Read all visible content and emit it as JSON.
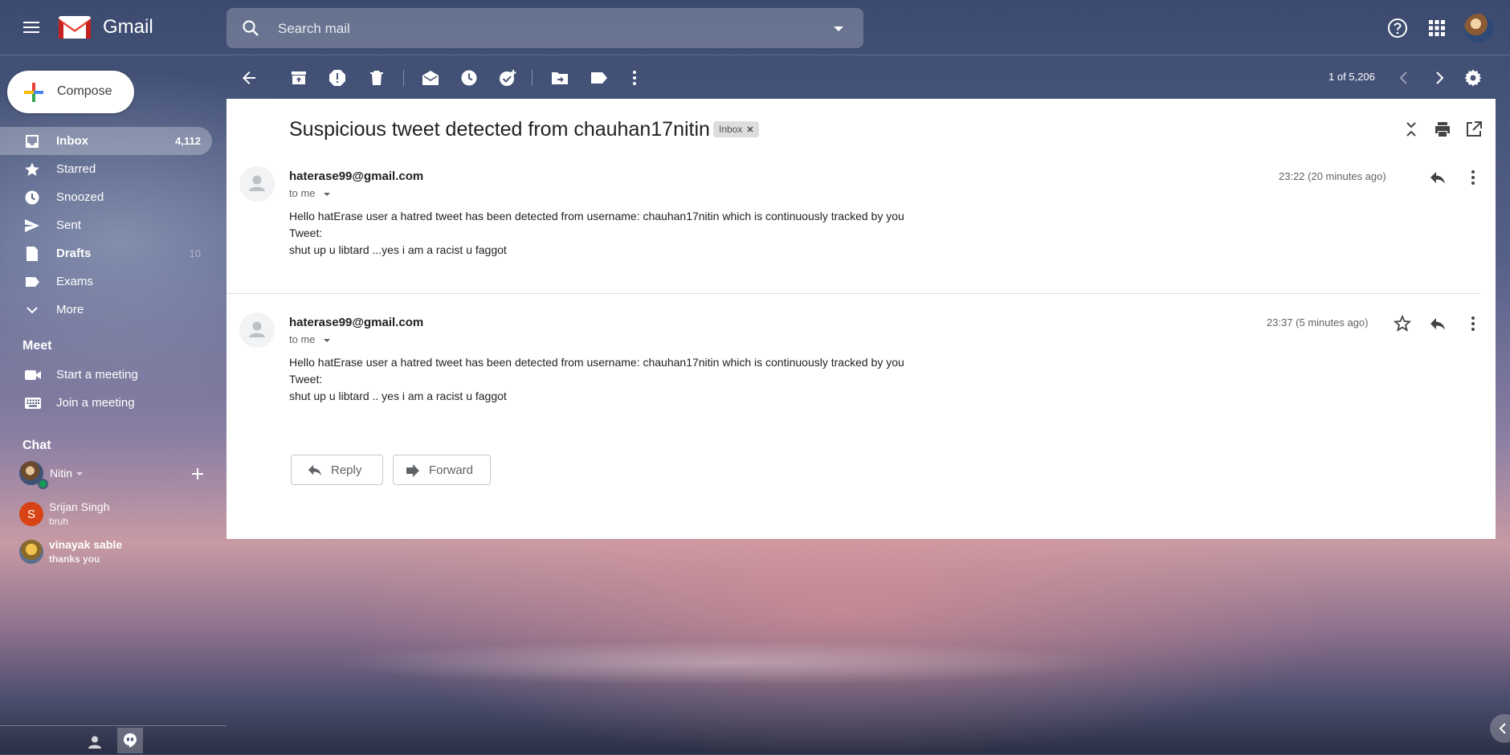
{
  "app": {
    "name": "Gmail"
  },
  "search": {
    "placeholder": "Search mail"
  },
  "compose": {
    "label": "Compose"
  },
  "nav": {
    "items": [
      {
        "label": "Inbox",
        "count": "4,112"
      },
      {
        "label": "Starred"
      },
      {
        "label": "Snoozed"
      },
      {
        "label": "Sent"
      },
      {
        "label": "Drafts",
        "count": "10"
      },
      {
        "label": "Exams"
      },
      {
        "label": "More"
      }
    ]
  },
  "meet": {
    "title": "Meet",
    "items": [
      {
        "label": "Start a meeting"
      },
      {
        "label": "Join a meeting"
      }
    ]
  },
  "chat": {
    "title": "Chat",
    "me": "Nitin",
    "contacts": [
      {
        "name": "Srijan Singh",
        "message": "bruh",
        "initial": "S"
      },
      {
        "name": "vinayak sable",
        "message": "thanks you"
      }
    ]
  },
  "toolbar": {
    "pager": "1 of 5,206"
  },
  "thread": {
    "subject": "Suspicious tweet detected from chauhan17nitin",
    "label": "Inbox",
    "messages": [
      {
        "from": "haterase99@gmail.com",
        "to": "to me",
        "time": "23:22 (20 minutes ago)",
        "line1": "Hello hatErase user a hatred tweet has been detected from username: chauhan17nitin which is continuously tracked by you",
        "line2": "Tweet:",
        "line3": "shut up u libtard ...yes i am a racist u faggot"
      },
      {
        "from": "haterase99@gmail.com",
        "to": "to me",
        "time": "23:37 (5 minutes ago)",
        "line1": "Hello hatErase user a hatred tweet has been detected from username: chauhan17nitin which is continuously tracked by you",
        "line2": "Tweet:",
        "line3": "shut up u libtard .. yes i am a racist u faggot"
      }
    ],
    "reply_label": "Reply",
    "forward_label": "Forward"
  },
  "colors": {
    "brand_red": "#ea4335",
    "panel_bg": "#ffffff",
    "accent_blue": "#1a73e8"
  }
}
